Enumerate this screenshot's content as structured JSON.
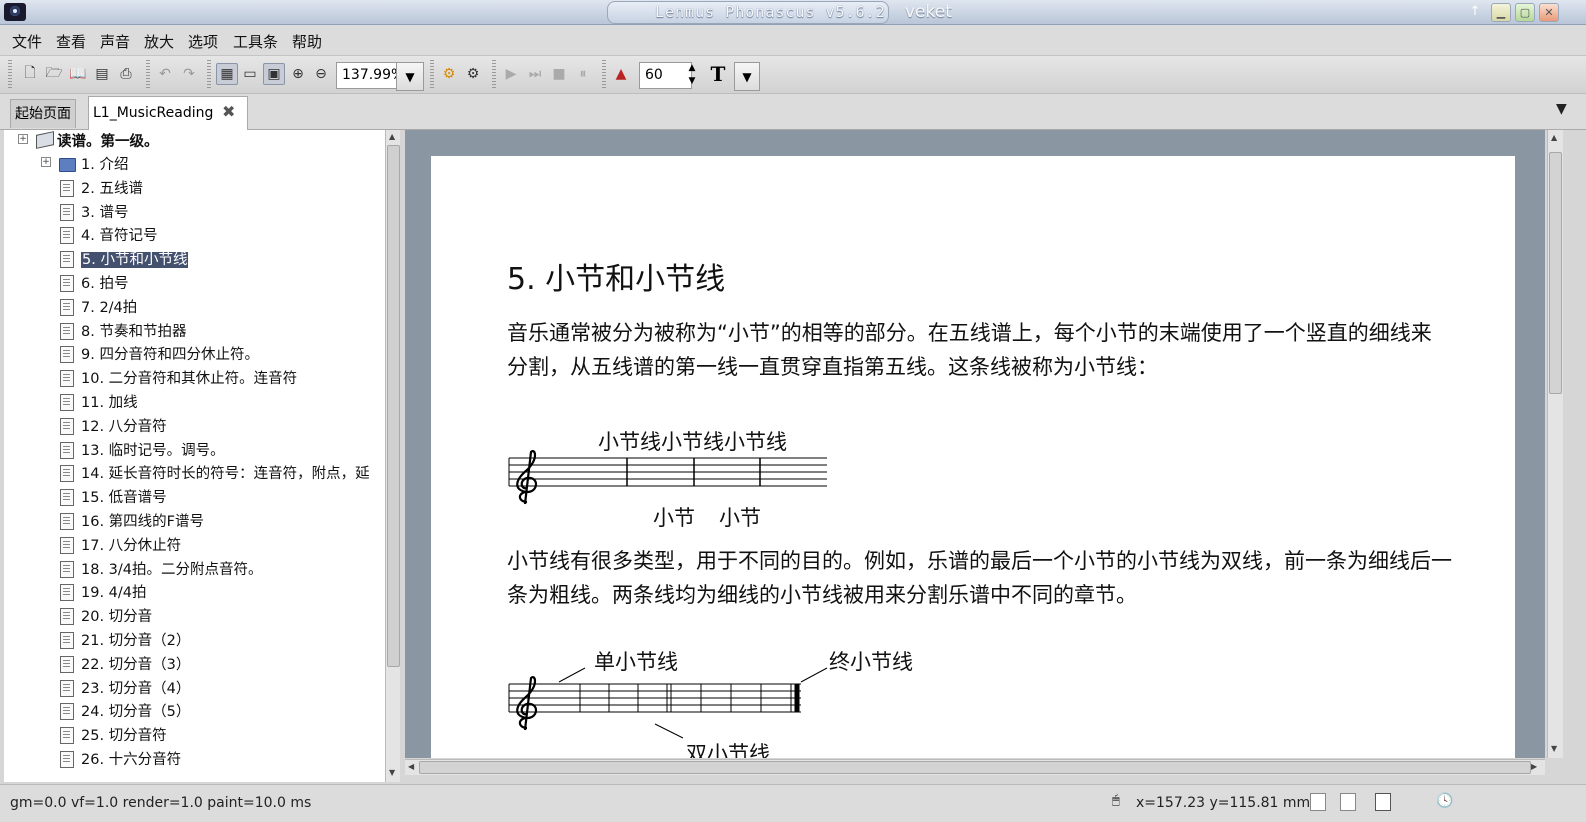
{
  "window": {
    "title": "Lenmus Phonascus v5.6.2",
    "user": "veket"
  },
  "menu": [
    "文件",
    "查看",
    "声音",
    "放大",
    "选项",
    "工具条",
    "帮助"
  ],
  "toolbar": {
    "zoom_value": "137.99%",
    "tempo_value": "60",
    "text_tool_label": "T"
  },
  "tabs": [
    {
      "label": "起始页面",
      "active": false
    },
    {
      "label": "L1_MusicReading",
      "active": true
    }
  ],
  "tree": {
    "root_label": "读谱。第一级。",
    "items": [
      {
        "label": "1. 介绍",
        "type": "folder"
      },
      {
        "label": "2. 五线谱",
        "type": "page"
      },
      {
        "label": "3. 谱号",
        "type": "page"
      },
      {
        "label": "4. 音符记号",
        "type": "page"
      },
      {
        "label": "5. 小节和小节线",
        "type": "page",
        "selected": true
      },
      {
        "label": "6. 拍号",
        "type": "page"
      },
      {
        "label": "7. 2/4拍",
        "type": "page"
      },
      {
        "label": "8. 节奏和节拍器",
        "type": "page"
      },
      {
        "label": "9. 四分音符和四分休止符。",
        "type": "page"
      },
      {
        "label": "10. 二分音符和其休止符。连音符",
        "type": "page"
      },
      {
        "label": "11. 加线",
        "type": "page"
      },
      {
        "label": "12. 八分音符",
        "type": "page"
      },
      {
        "label": "13. 临时记号。调号。",
        "type": "page"
      },
      {
        "label": "14. 延长音符时长的符号：连音符，附点，延",
        "type": "page"
      },
      {
        "label": "15. 低音谱号",
        "type": "page"
      },
      {
        "label": "16. 第四线的F谱号",
        "type": "page"
      },
      {
        "label": "17. 八分休止符",
        "type": "page"
      },
      {
        "label": "18. 3/4拍。二分附点音符。",
        "type": "page"
      },
      {
        "label": "19. 4/4拍",
        "type": "page"
      },
      {
        "label": "20. 切分音",
        "type": "page"
      },
      {
        "label": "21. 切分音（2）",
        "type": "page"
      },
      {
        "label": "22. 切分音（3）",
        "type": "page"
      },
      {
        "label": "23. 切分音（4）",
        "type": "page"
      },
      {
        "label": "24. 切分音（5）",
        "type": "page"
      },
      {
        "label": "25. 切分音符",
        "type": "page"
      },
      {
        "label": "26. 十六分音符",
        "type": "page"
      }
    ]
  },
  "document": {
    "heading": "5. 小节和小节线",
    "para1": "音乐通常被分为被称为“小节”的相等的部分。在五线谱上，每个小节的末端使用了一个竖直的细线来分割，从五线谱的第一线一直贯穿直指第五线。这条线被称为小节线：",
    "figure1": {
      "top_label": "小节线小节线小节线",
      "bottom_label_1": "小节",
      "bottom_label_2": "小节"
    },
    "para2": "小节线有很多类型，用于不同的目的。例如，乐谱的最后一个小节的小节线为双线，前一条为细线后一条为粗线。两条线均为细线的小节线被用来分割乐谱中不同的章节。",
    "figure2": {
      "label_single": "单小节线",
      "label_final": "终小节线",
      "label_double": "双小节线"
    }
  },
  "status": {
    "render_info": "gm=0.0 vf=1.0 render=1.0 paint=10.0 ms",
    "coords": "x=157.23 y=115.81 mm"
  }
}
